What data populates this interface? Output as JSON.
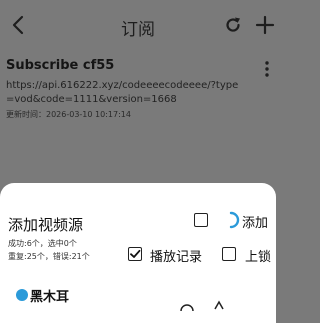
{
  "header": {
    "title": "订阅",
    "back_icon": "back-arrow-icon",
    "refresh_icon": "refresh-icon",
    "add_icon": "add-icon"
  },
  "subscription": {
    "name": "Subscribe cf55",
    "url": "https://api.616222.xyz/codeeeecodeeee/?type=vod&code=1111&version=1668",
    "updated": "更新时间：2026-03-10 10:17:14",
    "more_icon": "more-vertical-icon"
  },
  "sheet": {
    "title": "添加视频源",
    "stats_line1": "成功:6个，选中0个",
    "stats_line2": "重复:25个，错误:21个",
    "select_all_checked": false,
    "add_label": "添加",
    "history_label": "播放记录",
    "history_checked": true,
    "lock_label": "上锁",
    "lock_checked": false,
    "source_name": "黑木耳",
    "accent_color": "#2b9ad9"
  }
}
